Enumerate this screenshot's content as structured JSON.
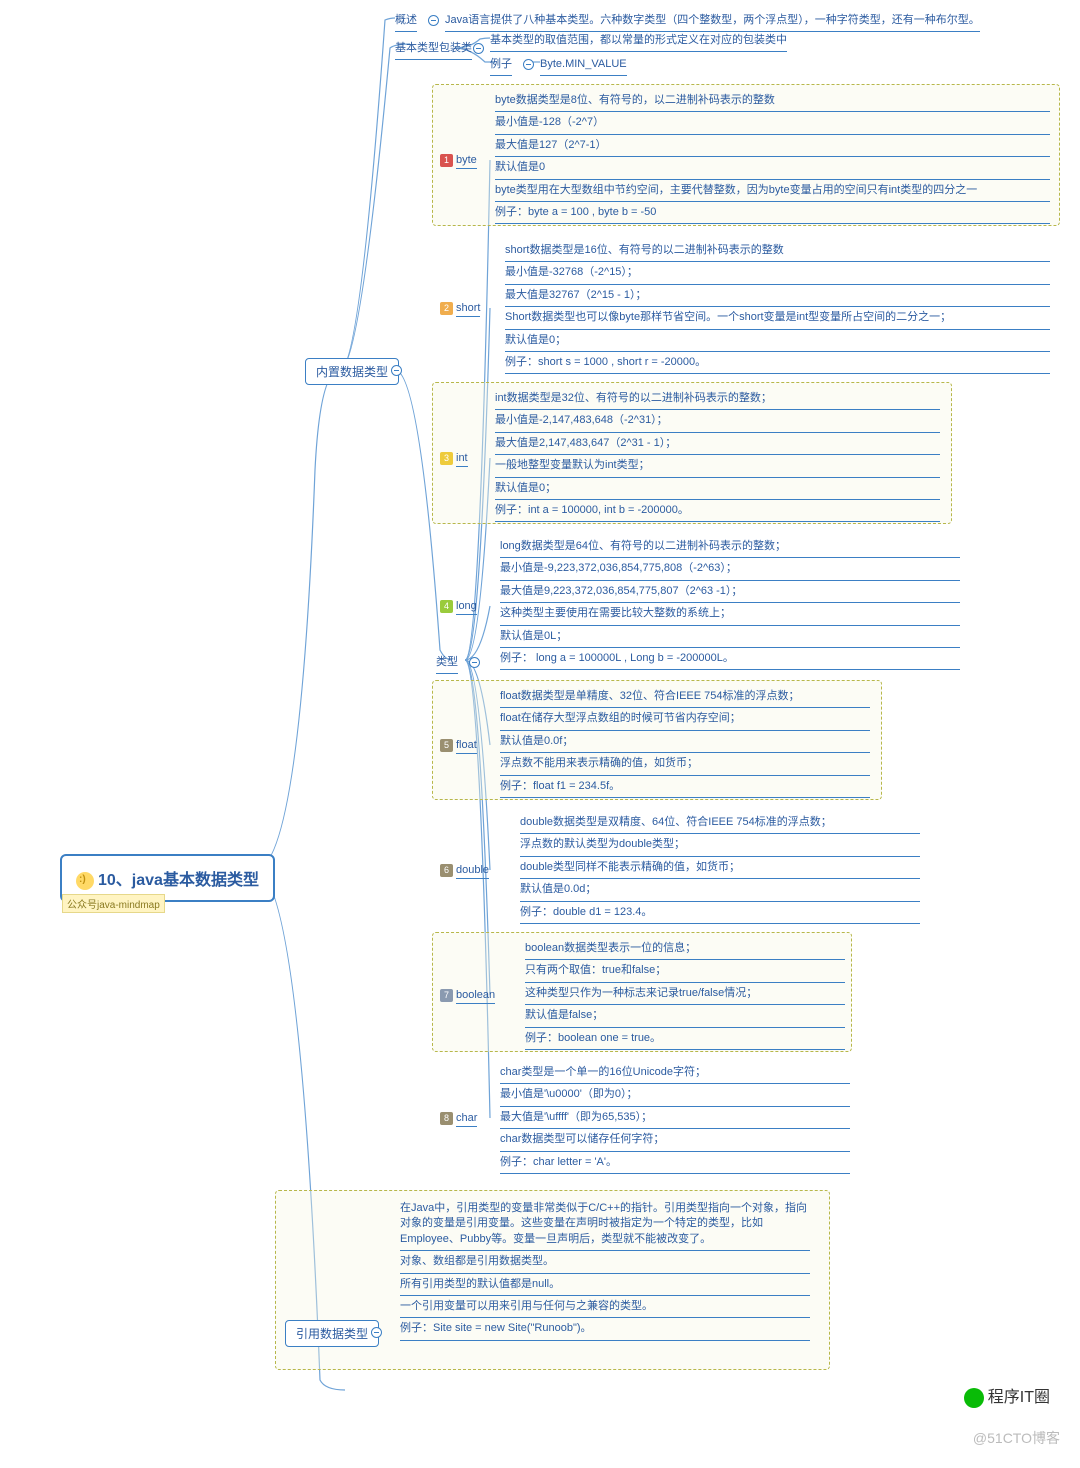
{
  "root": {
    "title": "10、java基本数据类型",
    "tag": "公众号java-mindmap"
  },
  "l1": {
    "overview_label": "概述",
    "overview_text": "Java语言提供了八种基本类型。六种数字类型（四个整数型，两个浮点型），一种字符类型，还有一种布尔型。",
    "wrapper_label": "基本类型包装类",
    "wrapper_text": "基本类型的取值范围，都以常量的形式定义在对应的包装类中",
    "example_label": "例子",
    "example_text": "Byte.MIN_VALUE",
    "builtin": "内置数据类型",
    "types": "类型",
    "reference": "引用数据类型"
  },
  "types": {
    "byte": {
      "name": "byte",
      "rows": [
        "byte数据类型是8位、有符号的，以二进制补码表示的整数",
        "最小值是-128（-2^7）",
        "最大值是127（2^7-1）",
        "默认值是0",
        "byte类型用在大型数组中节约空间，主要代替整数，因为byte变量占用的空间只有int类型的四分之一",
        "例子：byte a = 100 , byte b = -50"
      ]
    },
    "short": {
      "name": "short",
      "rows": [
        "short数据类型是16位、有符号的以二进制补码表示的整数",
        "最小值是-32768（-2^15）；",
        "最大值是32767（2^15 - 1）；",
        "Short数据类型也可以像byte那样节省空间。一个short变量是int型变量所占空间的二分之一；",
        "默认值是0；",
        "例子：short s = 1000 , short r = -20000。"
      ]
    },
    "int": {
      "name": "int",
      "rows": [
        "int数据类型是32位、有符号的以二进制补码表示的整数；",
        "最小值是-2,147,483,648（-2^31）；",
        "最大值是2,147,483,647（2^31 - 1）；",
        "一般地整型变量默认为int类型；",
        "默认值是0；",
        "例子：int a = 100000, int b = -200000。"
      ]
    },
    "long": {
      "name": "long",
      "rows": [
        "long数据类型是64位、有符号的以二进制补码表示的整数；",
        "最小值是-9,223,372,036,854,775,808（-2^63）；",
        "最大值是9,223,372,036,854,775,807（2^63 -1）；",
        "这种类型主要使用在需要比较大整数的系统上；",
        "默认值是0L；",
        "例子： long a = 100000L , Long b = -200000L。"
      ]
    },
    "float": {
      "name": "float",
      "rows": [
        "float数据类型是单精度、32位、符合IEEE 754标准的浮点数；",
        "float在储存大型浮点数组的时候可节省内存空间；",
        "默认值是0.0f；",
        "浮点数不能用来表示精确的值，如货币；",
        "例子：float f1 = 234.5f。"
      ]
    },
    "double": {
      "name": "double",
      "rows": [
        "double数据类型是双精度、64位、符合IEEE 754标准的浮点数；",
        "浮点数的默认类型为double类型；",
        "double类型同样不能表示精确的值，如货币；",
        "默认值是0.0d；",
        "例子：double d1 = 123.4。"
      ]
    },
    "boolean": {
      "name": "boolean",
      "rows": [
        "boolean数据类型表示一位的信息；",
        "只有两个取值：true和false；",
        "这种类型只作为一种标志来记录true/false情况；",
        "默认值是false；",
        "例子：boolean one = true。"
      ]
    },
    "char": {
      "name": "char",
      "rows": [
        "char类型是一个单一的16位Unicode字符；",
        "最小值是'\\u0000'（即为0）；",
        "最大值是'\\uffff'（即为65,535）；",
        "char数据类型可以储存任何字符；",
        "例子：char letter = 'A'。"
      ]
    }
  },
  "reference": {
    "rows": [
      "在Java中，引用类型的变量非常类似于C/C++的指针。引用类型指向一个对象，指向对象的变量是引用变量。这些变量在声明时被指定为一个特定的类型，比如Employee、Pubby等。变量一旦声明后，类型就不能被改变了。",
      "对象、数组都是引用数据类型。",
      "所有引用类型的默认值都是null。",
      "一个引用变量可以用来引用与任何与之兼容的类型。",
      "例子：Site site = new Site(\"Runoob\")。"
    ]
  },
  "watermark": {
    "w1": "程序IT圈",
    "w2": "@51CTO博客"
  }
}
